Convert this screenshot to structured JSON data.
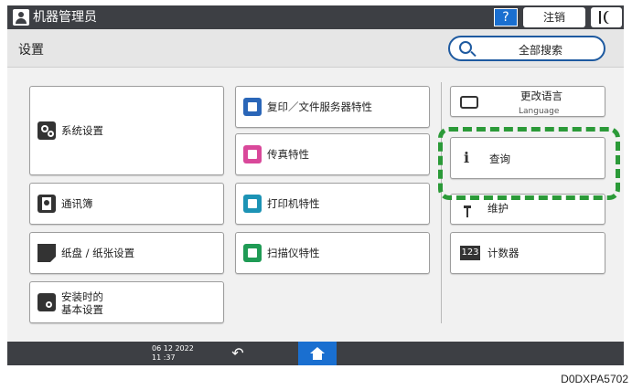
{
  "topbar": {
    "user_name": "机器管理员",
    "help_label": "?",
    "logout_label": "注销",
    "icons": [
      "user-icon",
      "power-icon"
    ]
  },
  "header": {
    "title": "设置",
    "search_label": "全部搜索",
    "search_icon": "search-icon"
  },
  "tiles": {
    "system_settings": {
      "label": "系统设置",
      "icon": "gear-icon"
    },
    "copy_doc_server": {
      "label": "复印／文件服务器特性",
      "icon": "copier-icon"
    },
    "fax": {
      "label": "传真特性",
      "icon": "fax-icon"
    },
    "address_book": {
      "label": "通讯簿",
      "icon": "address-book-icon"
    },
    "printer": {
      "label": "打印机特性",
      "icon": "printer-icon"
    },
    "tray_paper": {
      "label": "纸盘 / 纸张设置",
      "icon": "paper-tray-icon"
    },
    "scanner": {
      "label": "扫描仪特性",
      "icon": "scanner-icon"
    },
    "install_basic_line1": "安装时的",
    "install_basic_line2": "基本设置",
    "change_language": {
      "label": "更改语言",
      "sub": "Language"
    },
    "inquiry": {
      "label": "查询",
      "icon": "info-icon"
    },
    "maintenance": {
      "label": "维护"
    },
    "counter": {
      "label": "计数器",
      "icon_text": "123"
    }
  },
  "highlight_color": "#2b9a38",
  "bottombar": {
    "date": "06 12 2022",
    "time": "11 :37",
    "back_glyph": "↶"
  },
  "doc_code": "D0DXPA5702",
  "colors": {
    "bar": "#3d3f44",
    "accent_blue": "#1a6fd0",
    "search_border": "#1e5aa0"
  }
}
